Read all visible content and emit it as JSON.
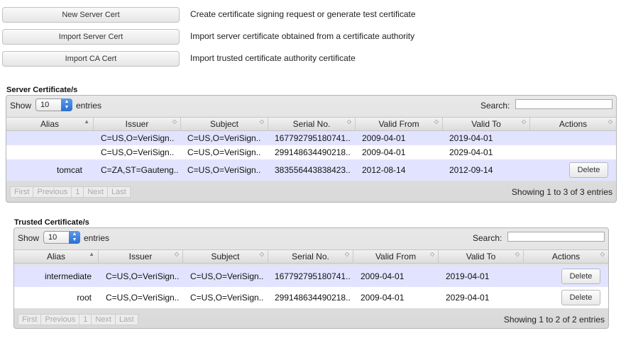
{
  "actions": [
    {
      "label": "New Server Cert",
      "desc": "Create certificate signing request or generate test certificate"
    },
    {
      "label": "Import Server Cert",
      "desc": "Import server certificate obtained from a certificate authority"
    },
    {
      "label": "Import CA Cert",
      "desc": "Import trusted certificate authority certificate"
    }
  ],
  "server": {
    "title": "Server Certificate/s",
    "show_label": "Show",
    "page_size": "10",
    "entries_label": "entries",
    "search_label": "Search:",
    "search_value": "",
    "columns": [
      "Alias",
      "Issuer",
      "Subject",
      "Serial No.",
      "Valid From",
      "Valid To",
      "Actions"
    ],
    "rows": [
      {
        "alias": "",
        "issuer": "C=US,O=VeriSign..",
        "subject": "C=US,O=VeriSign..",
        "serial": "167792795180741..",
        "from": "2009-04-01",
        "to": "2019-04-01",
        "action": ""
      },
      {
        "alias": "",
        "issuer": "C=US,O=VeriSign..",
        "subject": "C=US,O=VeriSign..",
        "serial": "299148634490218..",
        "from": "2009-04-01",
        "to": "2029-04-01",
        "action": ""
      },
      {
        "alias": "tomcat",
        "issuer": "C=ZA,ST=Gauteng..",
        "subject": "C=US,O=VeriSign..",
        "serial": "383556443838423..",
        "from": "2012-08-14",
        "to": "2012-09-14",
        "action": "Delete"
      }
    ],
    "pager": [
      "First",
      "Previous",
      "1",
      "Next",
      "Last"
    ],
    "showing": "Showing 1 to 3 of 3 entries"
  },
  "trusted": {
    "title": "Trusted Certificate/s",
    "show_label": "Show",
    "page_size": "10",
    "entries_label": "entries",
    "search_label": "Search:",
    "search_value": "",
    "columns": [
      "Alias",
      "Issuer",
      "Subject",
      "Serial No.",
      "Valid From",
      "Valid To",
      "Actions"
    ],
    "rows": [
      {
        "alias": "intermediate",
        "issuer": "C=US,O=VeriSign..",
        "subject": "C=US,O=VeriSign..",
        "serial": "167792795180741..",
        "from": "2009-04-01",
        "to": "2019-04-01",
        "action": "Delete"
      },
      {
        "alias": "root",
        "issuer": "C=US,O=VeriSign..",
        "subject": "C=US,O=VeriSign..",
        "serial": "299148634490218..",
        "from": "2009-04-01",
        "to": "2029-04-01",
        "action": "Delete"
      }
    ],
    "pager": [
      "First",
      "Previous",
      "1",
      "Next",
      "Last"
    ],
    "showing": "Showing 1 to 2 of 2 entries"
  }
}
